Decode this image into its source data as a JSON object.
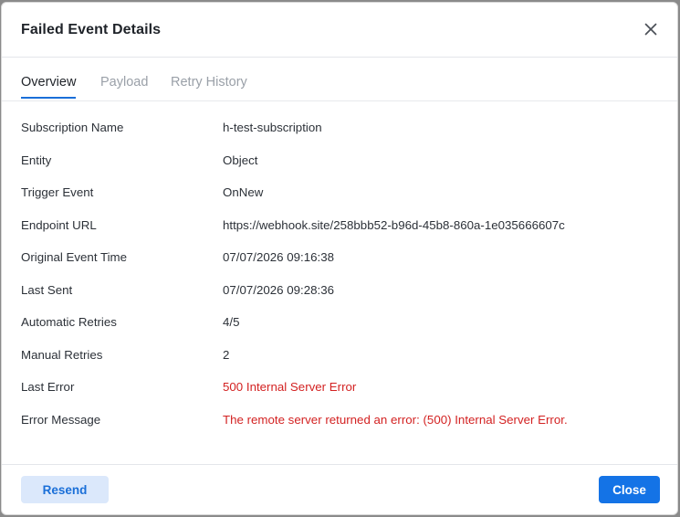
{
  "dialog": {
    "title": "Failed Event Details"
  },
  "tabs": [
    {
      "label": "Overview",
      "active": true
    },
    {
      "label": "Payload",
      "active": false
    },
    {
      "label": "Retry History",
      "active": false
    }
  ],
  "details": [
    {
      "label": "Subscription Name",
      "value": "h-test-subscription"
    },
    {
      "label": "Entity",
      "value": "Object"
    },
    {
      "label": "Trigger Event",
      "value": "OnNew"
    },
    {
      "label": "Endpoint URL",
      "value": "https://webhook.site/258bbb52-b96d-45b8-860a-1e035666607c"
    },
    {
      "label": "Original Event Time",
      "value": "07/07/2026 09:16:38"
    },
    {
      "label": "Last Sent",
      "value": "07/07/2026 09:28:36"
    },
    {
      "label": "Automatic Retries",
      "value": "4/5"
    },
    {
      "label": "Manual Retries",
      "value": "2"
    },
    {
      "label": "Last Error",
      "value": "500 Internal Server Error"
    },
    {
      "label": "Error Message",
      "value": "The remote server returned an error: (500) Internal Server Error."
    }
  ],
  "footer": {
    "resend_label": "Resend",
    "close_label": "Close"
  },
  "colors": {
    "accent": "#1473e6",
    "error": "#d32222",
    "resend_bg": "#dbe8fb"
  }
}
